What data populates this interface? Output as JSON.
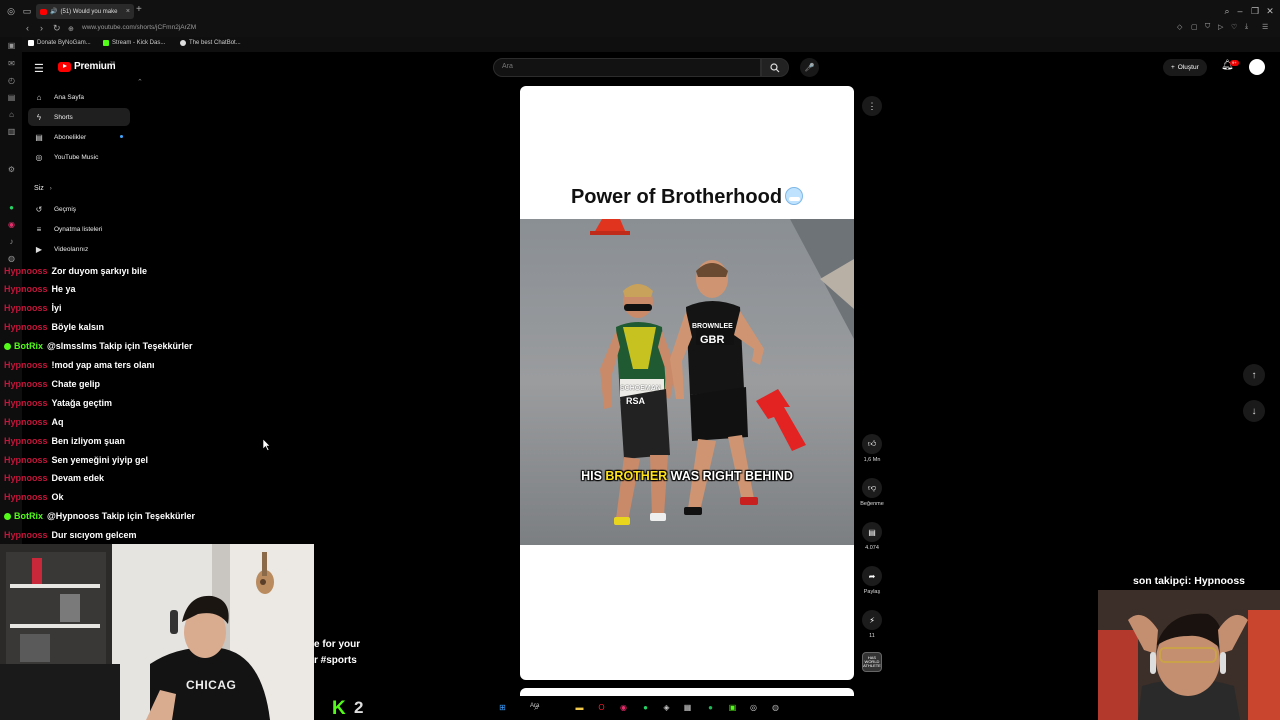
{
  "browser": {
    "tab_title": "(51) Would you make",
    "url": "www.youtube.com/shorts/jCFmn2jArZM",
    "bookmarks": [
      {
        "label": "Donate ByNoGam...",
        "color": "#ffffff"
      },
      {
        "label": "Stream - Kick Das...",
        "color": "#53fc18"
      },
      {
        "label": "The best ChatBot...",
        "color": "#dddddd"
      }
    ]
  },
  "youtube": {
    "logo_text": "Premium",
    "logo_sup": "TR",
    "search_placeholder": "Ara",
    "create_label": "Oluştur",
    "notif_count": "9+",
    "sidebar": {
      "items": [
        {
          "label": "Ana Sayfa",
          "icon": "home-icon"
        },
        {
          "label": "Shorts",
          "icon": "shorts-icon"
        },
        {
          "label": "Abonelikler",
          "icon": "subscriptions-icon"
        },
        {
          "label": "YouTube Music",
          "icon": "music-icon"
        }
      ],
      "section_you": "Siz",
      "you_items": [
        {
          "label": "Geçmiş",
          "icon": "history-icon"
        },
        {
          "label": "Oynatma listeleri",
          "icon": "playlist-icon"
        },
        {
          "label": "Videolarınız",
          "icon": "videos-icon"
        }
      ]
    }
  },
  "short": {
    "title": "Power of Brotherhood",
    "caption_pre": "HIS ",
    "caption_hl": "BROTHER",
    "caption_post": " WAS RIGHT BEHIND",
    "actions": {
      "likes": "1,6 Mn",
      "dislike_label": "Beğenme",
      "comments": "4.074",
      "share_label": "Paylaş",
      "remix": "11"
    },
    "channel_badge": "HAS WORLD ATHLETE",
    "runner_left": {
      "bib": "SCHOEMAN",
      "country": "RSA"
    },
    "runner_right": {
      "bib": "BROWNLEE",
      "country": "GBR"
    }
  },
  "chat": [
    {
      "user": "Hypnooss",
      "type": "hyp",
      "text": "Zor duyom şarkıyı bile"
    },
    {
      "user": "Hypnooss",
      "type": "hyp",
      "text": "He ya"
    },
    {
      "user": "Hypnooss",
      "type": "hyp",
      "text": "İyi"
    },
    {
      "user": "Hypnooss",
      "type": "hyp",
      "text": "Böyle kalsın"
    },
    {
      "user": "BotRix",
      "type": "bot",
      "text": "@slmsslms Takip için Teşekkürler"
    },
    {
      "user": "Hypnooss",
      "type": "hyp",
      "text": "!mod yap ama ters olanı"
    },
    {
      "user": "Hypnooss",
      "type": "hyp",
      "text": "Chate gelip"
    },
    {
      "user": "Hypnooss",
      "type": "hyp",
      "text": "Yatağa geçtim"
    },
    {
      "user": "Hypnooss",
      "type": "hyp",
      "text": "Aq"
    },
    {
      "user": "Hypnooss",
      "type": "hyp",
      "text": "Ben izliyom şuan"
    },
    {
      "user": "Hypnooss",
      "type": "hyp",
      "text": "Sen yemeğini yiyip gel"
    },
    {
      "user": "Hypnooss",
      "type": "hyp",
      "text": "Devam edek"
    },
    {
      "user": "Hypnooss",
      "type": "hyp",
      "text": "Ok"
    },
    {
      "user": "BotRix",
      "type": "bot",
      "text": "@Hypnooss Takip için Teşekkürler"
    },
    {
      "user": "Hypnooss",
      "type": "hyp",
      "text": "Dur sıcıyom gelcem"
    }
  ],
  "stream": {
    "last_follower": "son takipçi: Hypnooss",
    "partial_line1": "e for your",
    "partial_line2": "r #sports",
    "shirt_text": "CHICAG",
    "kick_count": "2",
    "taskbar_search": "Ara"
  },
  "colors": {
    "kick_green": "#53fc18",
    "yt_red": "#ff0000",
    "hyp_user": "#c4153a",
    "caption_highlight": "#ffe31a"
  }
}
